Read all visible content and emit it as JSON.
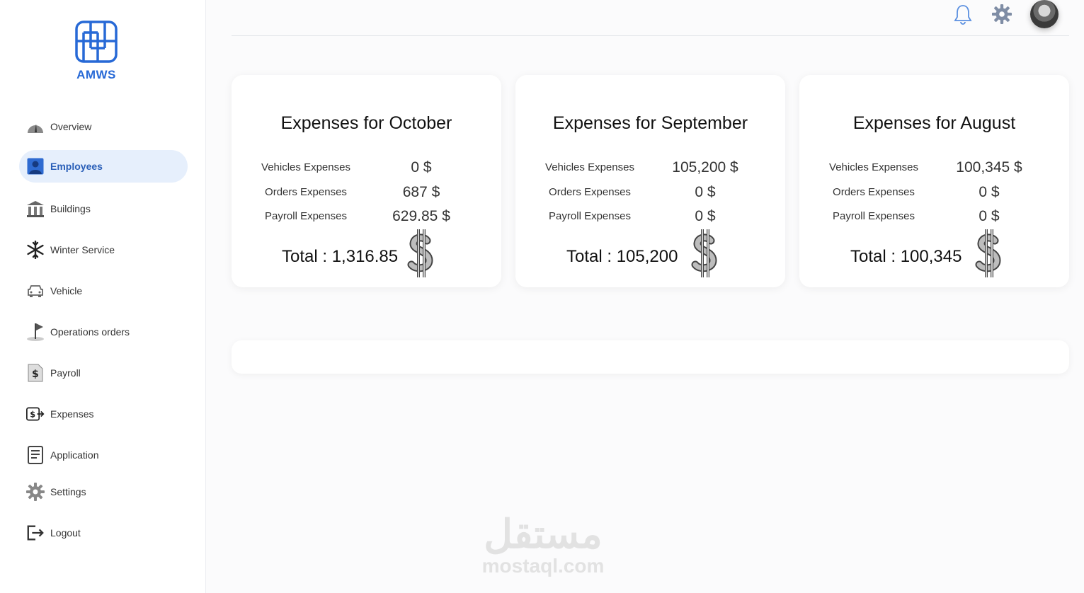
{
  "brand": {
    "name": "AMWS"
  },
  "sidebar": {
    "items": [
      {
        "label": "Overview",
        "icon": "gauge-icon"
      },
      {
        "label": "Employees",
        "icon": "user-icon",
        "active": true
      },
      {
        "label": "Buildings",
        "icon": "building-icon"
      },
      {
        "label": "Winter Service",
        "icon": "snowflake-icon"
      },
      {
        "label": "Vehicle",
        "icon": "car-icon"
      },
      {
        "label": "Operations orders",
        "icon": "flag-icon"
      },
      {
        "label": "Payroll",
        "icon": "payroll-icon"
      },
      {
        "label": "Expenses",
        "icon": "expenses-icon"
      },
      {
        "label": "Application",
        "icon": "document-icon"
      },
      {
        "label": "Settings",
        "icon": "gear-icon"
      },
      {
        "label": "Logout",
        "icon": "logout-icon"
      }
    ]
  },
  "header": {
    "icons": [
      "bell-icon",
      "gear-icon",
      "avatar"
    ]
  },
  "cards": [
    {
      "title": "Expenses for October",
      "rows": [
        {
          "label": "Vehicles Expenses",
          "value": "0 $"
        },
        {
          "label": "Orders Expenses",
          "value": "687 $"
        },
        {
          "label": "Payroll Expenses",
          "value": "629.85 $"
        }
      ],
      "total": "Total : 1,316.85"
    },
    {
      "title": "Expenses for September",
      "rows": [
        {
          "label": "Vehicles Expenses",
          "value": "105,200 $"
        },
        {
          "label": "Orders Expenses",
          "value": "0 $"
        },
        {
          "label": "Payroll Expenses",
          "value": "0 $"
        }
      ],
      "total": "Total : 105,200"
    },
    {
      "title": "Expenses for August",
      "rows": [
        {
          "label": "Vehicles Expenses",
          "value": "100,345 $"
        },
        {
          "label": "Orders Expenses",
          "value": "0 $"
        },
        {
          "label": "Payroll Expenses",
          "value": "0 $"
        }
      ],
      "total": "Total : 100,345"
    }
  ],
  "watermark": {
    "arabic": "مستقل",
    "latin": "mostaql.com"
  },
  "colors": {
    "accent": "#2769d6",
    "active_bg": "#e6effc"
  }
}
